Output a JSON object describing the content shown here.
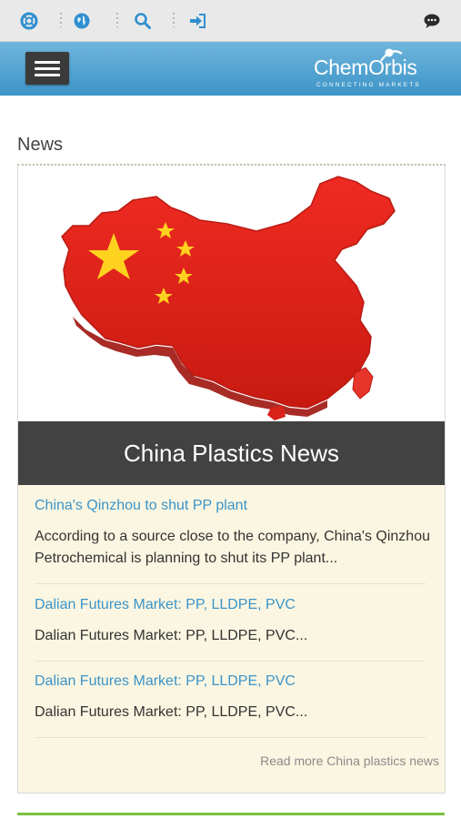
{
  "topbar": {
    "icons": [
      "lifebuoy-icon",
      "globe-icon",
      "search-icon",
      "login-icon",
      "chat-icon"
    ],
    "icon_color": "#2f8fcf"
  },
  "header": {
    "logo_text": "ChemOrbis",
    "logo_tagline": "CONNECTING MARKETS",
    "bg_color": "#4aa3d3"
  },
  "section": {
    "title": "News"
  },
  "card": {
    "hero_caption": "China Plastics News",
    "items": [
      {
        "link": "China's Qinzhou to shut PP plant",
        "text": "According to a source close to the company, China's Qinzhou Petrochemical is planning to shut its PP plant..."
      },
      {
        "link": "Dalian Futures Market: PP, LLDPE, PVC",
        "text": "Dalian Futures Market: PP, LLDPE, PVC..."
      },
      {
        "link": "Dalian Futures Market: PP, LLDPE, PVC",
        "text": "Dalian Futures Market: PP, LLDPE, PVC..."
      }
    ],
    "read_more": "Read more China plastics news"
  },
  "colors": {
    "link": "#3b94c9",
    "card_bg": "#fbf6e1",
    "caption_bg": "#424242",
    "accent_green": "#7cc043"
  }
}
